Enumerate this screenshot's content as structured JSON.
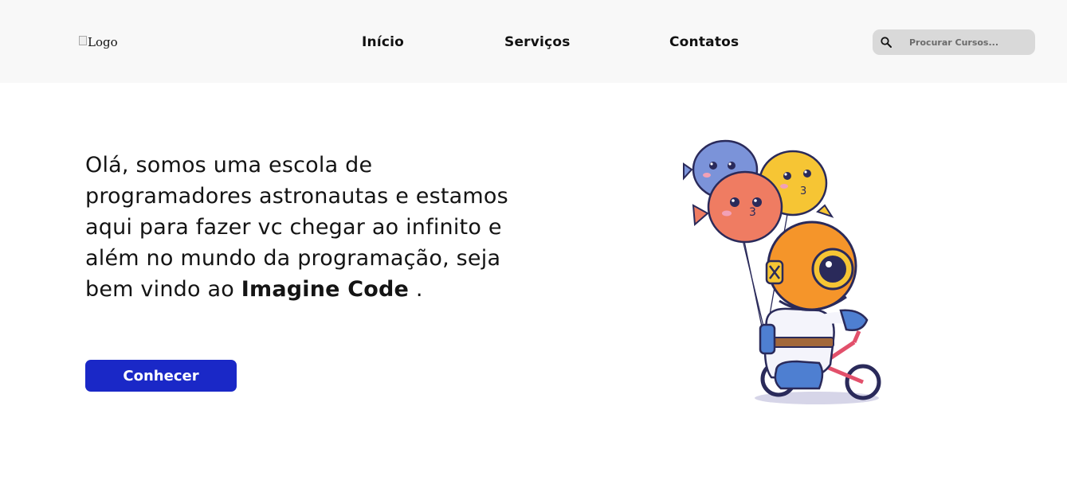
{
  "header": {
    "logo_alt": "Logo",
    "nav": [
      {
        "label": "Início"
      },
      {
        "label": "Serviços"
      },
      {
        "label": "Contatos"
      }
    ],
    "search": {
      "placeholder": "Procurar Cursos...",
      "icon": "search-icon"
    }
  },
  "hero": {
    "text": "Olá, somos uma escola de programadores astronautas e estamos aqui para fazer vc chegar ao infinito e além no mundo da programação, seja bem vindo ao",
    "brand": "Imagine Code",
    "suffix": " .",
    "button_label": "Conhecer"
  },
  "illustration": {
    "subject": "astronaut-diver-on-bike-with-pufferfish-balloons"
  },
  "colors": {
    "header_bg": "#f8f8f8",
    "button_bg": "#1a28c7",
    "search_bg": "#d9d9d9"
  }
}
